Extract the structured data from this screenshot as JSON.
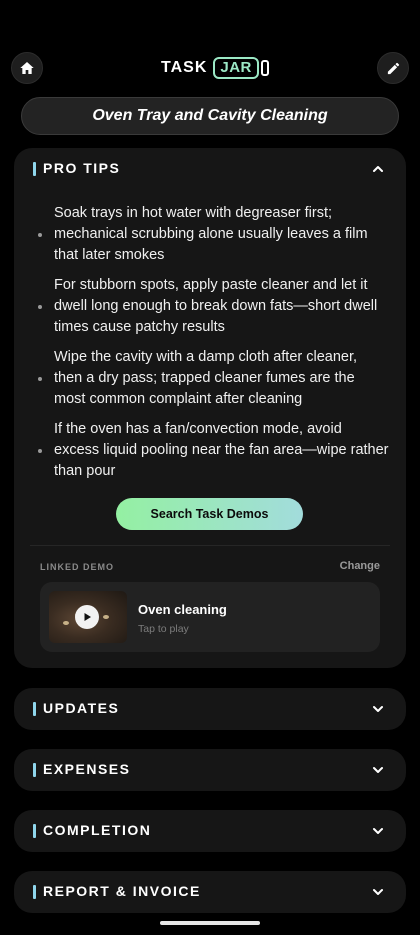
{
  "header": {
    "home_icon": "home-icon",
    "edit_icon": "pencil-icon",
    "logo_task": "TASK",
    "logo_jar": "JAR"
  },
  "job_title": "Oven Tray and Cavity Cleaning",
  "pro_tips": {
    "title": "PRO TIPS",
    "expanded": true,
    "tips": [
      "Soak trays in hot water with degreaser first; mechanical scrubbing alone usually leaves a film that later smokes",
      "For stubborn spots, apply paste cleaner and let it dwell long enough to break down fats—short dwell times cause patchy results",
      "Wipe the cavity with a damp cloth after cleaner, then a dry pass; trapped cleaner fumes are the most common complaint after cleaning",
      "If the oven has a fan/convection mode, avoid excess liquid pooling near the fan area—wipe rather than pour"
    ],
    "search_button": "Search Task Demos",
    "linked_demo_label": "LINKED DEMO",
    "change_label": "Change",
    "demo": {
      "title": "Oven cleaning",
      "subtitle": "Tap to play"
    }
  },
  "sections": [
    {
      "title": "UPDATES",
      "expanded": false
    },
    {
      "title": "EXPENSES",
      "expanded": false
    },
    {
      "title": "COMPLETION",
      "expanded": false
    },
    {
      "title": "REPORT & INVOICE",
      "expanded": false
    }
  ],
  "colors": {
    "accent_bar": "#8fd6ec",
    "logo_jar": "#9be8c5",
    "button_gradient_start": "#94f0a2",
    "button_gradient_end": "#a2dcdc",
    "card_bg": "#161616"
  }
}
